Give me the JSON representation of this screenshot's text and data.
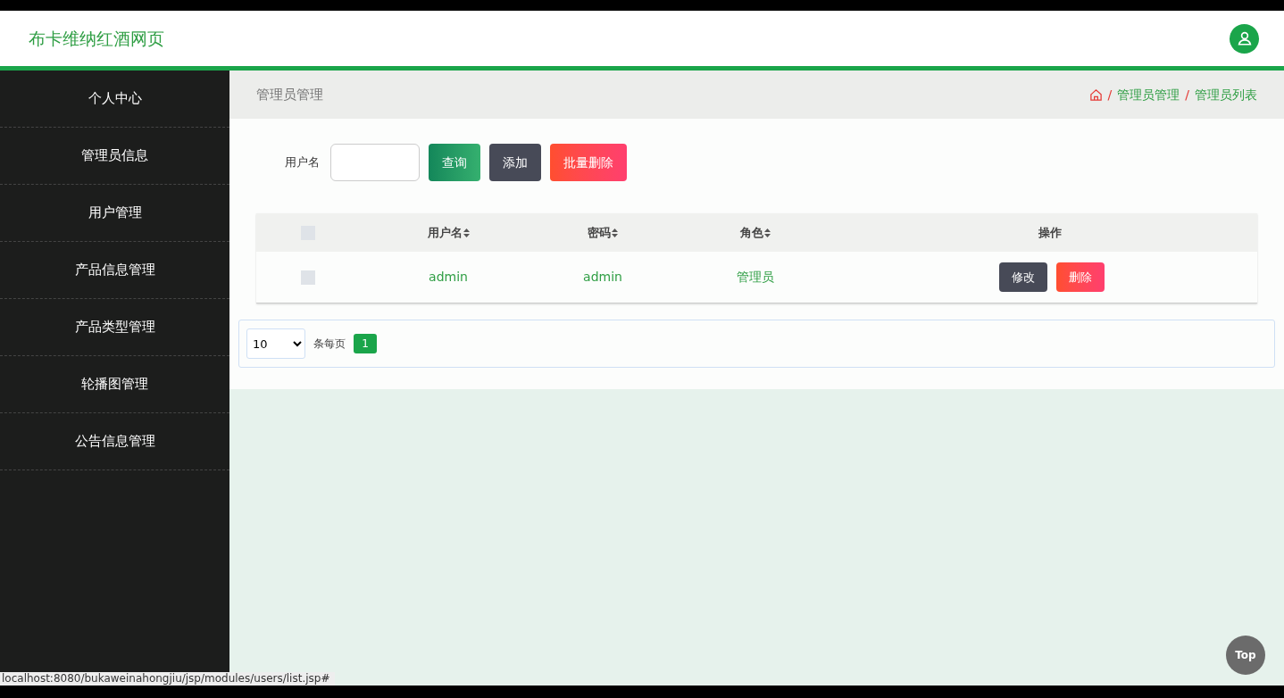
{
  "header": {
    "title": "布卡维纳红酒网页"
  },
  "sidebar": {
    "items": [
      {
        "label": "个人中心"
      },
      {
        "label": "管理员信息"
      },
      {
        "label": "用户管理"
      },
      {
        "label": "产品信息管理"
      },
      {
        "label": "产品类型管理"
      },
      {
        "label": "轮播图管理"
      },
      {
        "label": "公告信息管理"
      }
    ]
  },
  "page_title": "管理员管理",
  "breadcrumb": [
    {
      "separator": "/",
      "label": "管理员管理"
    },
    {
      "separator": "/",
      "label": "管理员列表"
    }
  ],
  "search": {
    "label": "用户名"
  },
  "toolbar": [
    {
      "label": "查询",
      "kind": "primary"
    },
    {
      "label": "添加",
      "kind": "dark"
    },
    {
      "label": "批量删除",
      "kind": "danger"
    }
  ],
  "table": {
    "select_all_checked": false,
    "columns": [
      {
        "label": "用户名",
        "sortable": true
      },
      {
        "label": "密码",
        "sortable": true
      },
      {
        "label": "角色",
        "sortable": true
      },
      {
        "label": "操作",
        "sortable": false
      }
    ],
    "rows": [
      {
        "checked": false,
        "cells": [
          "admin",
          "admin",
          "管理员"
        ],
        "actions": [
          {
            "label": "修改",
            "kind": "dark"
          },
          {
            "label": "删除",
            "kind": "danger"
          }
        ]
      }
    ]
  },
  "pagination": {
    "page_size": "10",
    "page_size_label": "条每页",
    "pages": [
      {
        "label": "1",
        "selected": true
      }
    ]
  },
  "top_button": "Top",
  "status_url": "localhost:8080/bukaweinahongjiu/jsp/modules/users/list.jsp#"
}
